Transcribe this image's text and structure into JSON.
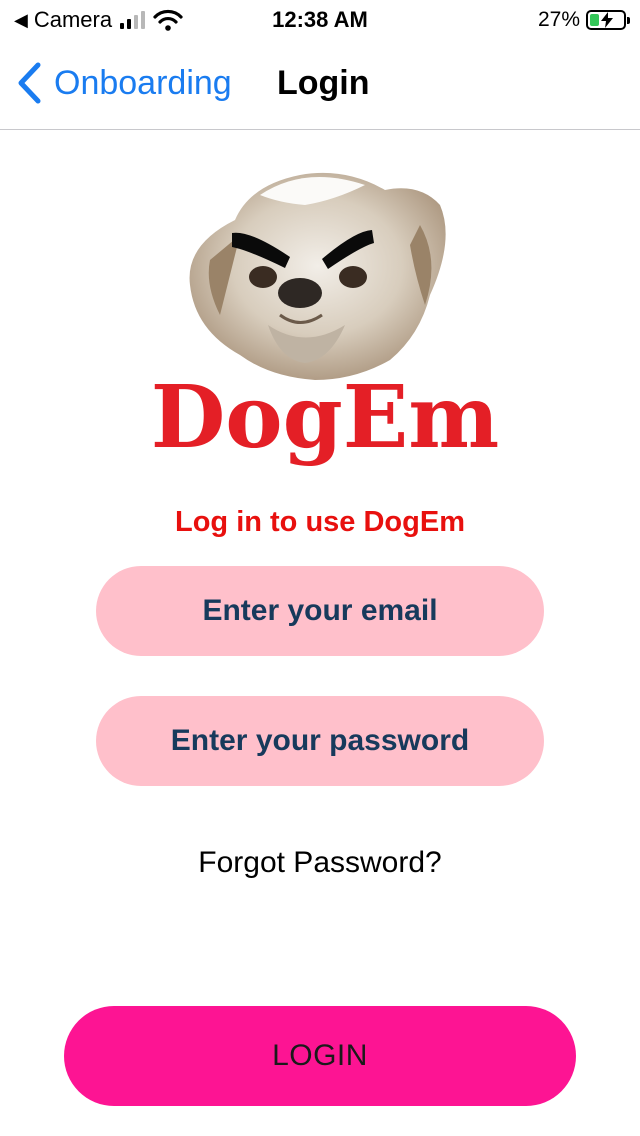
{
  "status_bar": {
    "back_app": "Camera",
    "time": "12:38 AM",
    "battery": "27%",
    "signal_bars_filled": 2,
    "signal_bars_total": 4
  },
  "nav": {
    "back_label": "Onboarding",
    "title": "Login"
  },
  "logo": {
    "text": "DogEm"
  },
  "form": {
    "prompt": "Log in to use DogEm",
    "email_placeholder": "Enter your email",
    "password_placeholder": "Enter your password",
    "forgot_label": "Forgot Password?",
    "login_label": "LOGIN"
  },
  "colors": {
    "accent_blue": "#1a7cf0",
    "prompt_red": "#e8100e",
    "field_pink": "#ffc0cb",
    "login_pink": "#fd1493",
    "logo_red": "#e41f26"
  }
}
